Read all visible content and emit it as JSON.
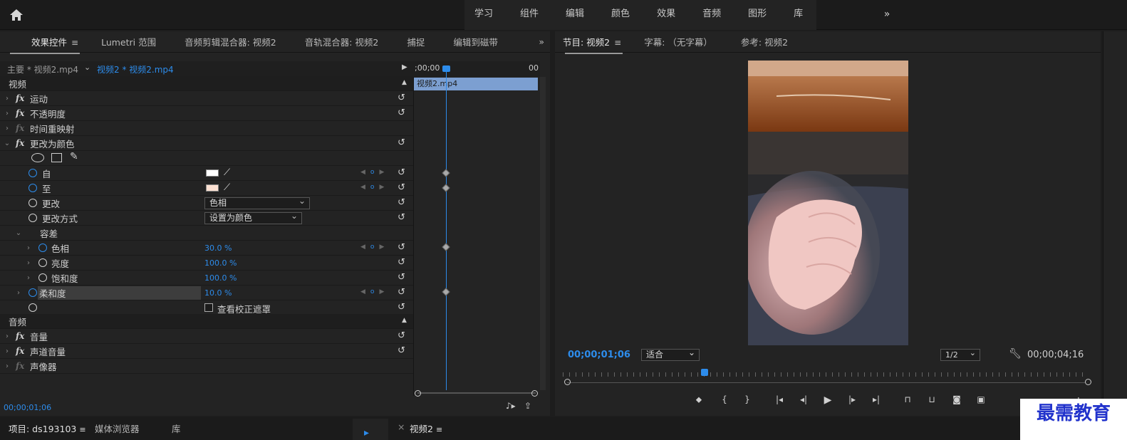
{
  "workspaces": [
    "学习",
    "组件",
    "编辑",
    "颜色",
    "效果",
    "音频",
    "图形",
    "库"
  ],
  "ec_tabs": [
    {
      "label": "效果控件",
      "active": true
    },
    {
      "label": "Lumetri 范围"
    },
    {
      "label": "音频剪辑混合器: 视频2"
    },
    {
      "label": "音轨混合器: 视频2"
    },
    {
      "label": "捕捉"
    },
    {
      "label": "编辑到磁带"
    }
  ],
  "ec_sub": {
    "master": "主要 * 视频2.mp4",
    "clip": "视频2 * 视频2.mp4"
  },
  "tl": {
    "start": ";00;00",
    "end": "00",
    "clip": "视频2.mp4"
  },
  "rows": {
    "video": "视频",
    "motion": "运动",
    "opacity": "不透明度",
    "timeremap": "时间重映射",
    "changecolor": "更改为颜色",
    "from": "自",
    "to": "至",
    "change": "更改",
    "change_val": "色相",
    "method": "更改方式",
    "method_val": "设置为颜色",
    "tolerance": "容差",
    "hue": "色相",
    "hue_val": "30.0 %",
    "light": "亮度",
    "light_val": "100.0 %",
    "sat": "饱和度",
    "sat_val": "100.0 %",
    "soft": "柔和度",
    "soft_val": "10.0 %",
    "mask": "查看校正遮罩",
    "audio": "音频",
    "volume": "音量",
    "channel": "声道音量",
    "panner": "声像器"
  },
  "ec_timecode": "00;00;01;06",
  "pm_tabs": [
    {
      "label": "节目: 视频2",
      "active": true
    },
    {
      "label": "字幕: （无字幕）"
    },
    {
      "label": "参考: 视频2"
    }
  ],
  "pm": {
    "tc_current": "00;00;01;06",
    "fit": "适合",
    "quality": "1/2",
    "tc_duration": "00;00;04;16"
  },
  "bottom": {
    "project": "项目: ds193103",
    "media": "媒体浏览器",
    "lib": "库",
    "seq": "视频2"
  },
  "watermark": "最需教育",
  "colors": {
    "accent": "#2d8ceb",
    "clip": "#7c9fd1",
    "from_swatch": "#ffffff",
    "to_swatch": "#fbe0d2"
  }
}
